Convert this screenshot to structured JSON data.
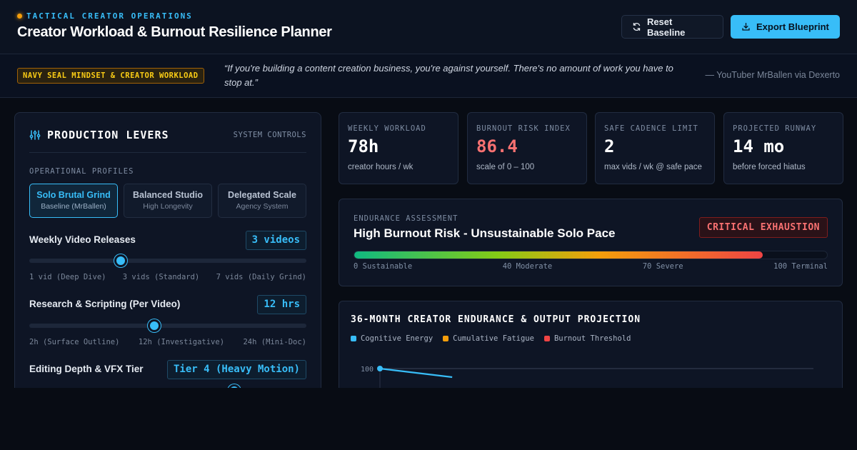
{
  "header": {
    "brand_tag": "TACTICAL CREATOR OPERATIONS",
    "title": "Creator Workload & Burnout Resilience Planner",
    "reset_label": "Reset Baseline",
    "export_label": "Export Blueprint",
    "accent": "#38bdf8",
    "status_dot_color": "#f59e0b"
  },
  "quote": {
    "badge": "NAVY SEAL MINDSET & CREATOR WORKLOAD",
    "text": "“If you're building a content creation business, you're against yourself. There's no amount of work you have to stop at.”",
    "source": "— YouTuber MrBallen via Dexerto"
  },
  "levers": {
    "title": "PRODUCTION LEVERS",
    "subtitle": "SYSTEM CONTROLS",
    "profiles_label": "OPERATIONAL PROFILES",
    "profiles": [
      {
        "name": "Solo Brutal Grind",
        "sub": "Baseline (MrBallen)",
        "active": true
      },
      {
        "name": "Balanced Studio",
        "sub": "High Longevity",
        "active": false
      },
      {
        "name": "Delegated Scale",
        "sub": "Agency System",
        "active": false
      }
    ],
    "releases": {
      "label": "Weekly Video Releases",
      "value": "3 videos",
      "level": 0.33,
      "ticks": [
        "1 vid (Deep Dive)",
        "3 vids (Standard)",
        "7 vids (Daily Grind)"
      ]
    },
    "research": {
      "label": "Research & Scripting (Per Video)",
      "value": "12 hrs",
      "level": 0.45,
      "ticks": [
        "2h (Surface Outline)",
        "12h (Investigative)",
        "24h (Mini-Doc)"
      ]
    },
    "editing": {
      "label": "Editing Depth & VFX Tier",
      "value": "Tier 4 (Heavy Motion)",
      "level": 0.74
    }
  },
  "kpis": [
    {
      "label": "WEEKLY WORKLOAD",
      "value": "78h",
      "unit": "creator hours / wk",
      "color": "#ffffff"
    },
    {
      "label": "BURNOUT RISK INDEX",
      "value": "86.4",
      "unit": "scale of 0 – 100",
      "color": "#f87171"
    },
    {
      "label": "SAFE CADENCE LIMIT",
      "value": "2",
      "unit": "max vids / wk @ safe pace",
      "color": "#ffffff"
    },
    {
      "label": "PROJECTED RUNWAY",
      "value": "14 mo",
      "unit": "before forced hiatus",
      "color": "#ffffff"
    }
  ],
  "endurance": {
    "label": "ENDURANCE ASSESSMENT",
    "title": "High Burnout Risk - Unsustainable Solo Pace",
    "badge": "CRITICAL EXHAUSTION",
    "risk_level": 0.864,
    "ticks": [
      "0 Sustainable",
      "40 Moderate",
      "70 Severe",
      "100 Terminal"
    ]
  },
  "projection": {
    "title": "36-MONTH CREATOR ENDURANCE & OUTPUT PROJECTION",
    "legend": [
      {
        "name": "Cognitive Energy",
        "color": "#38bdf8"
      },
      {
        "name": "Cumulative Fatigue",
        "color": "#f59e0b"
      },
      {
        "name": "Burnout Threshold",
        "color": "#ef4444"
      }
    ],
    "y_tick": "100"
  },
  "chart_data": {
    "type": "line",
    "title": "36-MONTH CREATOR ENDURANCE & OUTPUT PROJECTION",
    "xlabel": "",
    "ylabel": "",
    "yticks": [
      100
    ],
    "series": [
      {
        "name": "Cognitive Energy",
        "x": [
          0,
          6
        ],
        "values": [
          100,
          94
        ]
      }
    ],
    "xlim": [
      0,
      36
    ],
    "note_visible": "only top portion of chart visible"
  }
}
